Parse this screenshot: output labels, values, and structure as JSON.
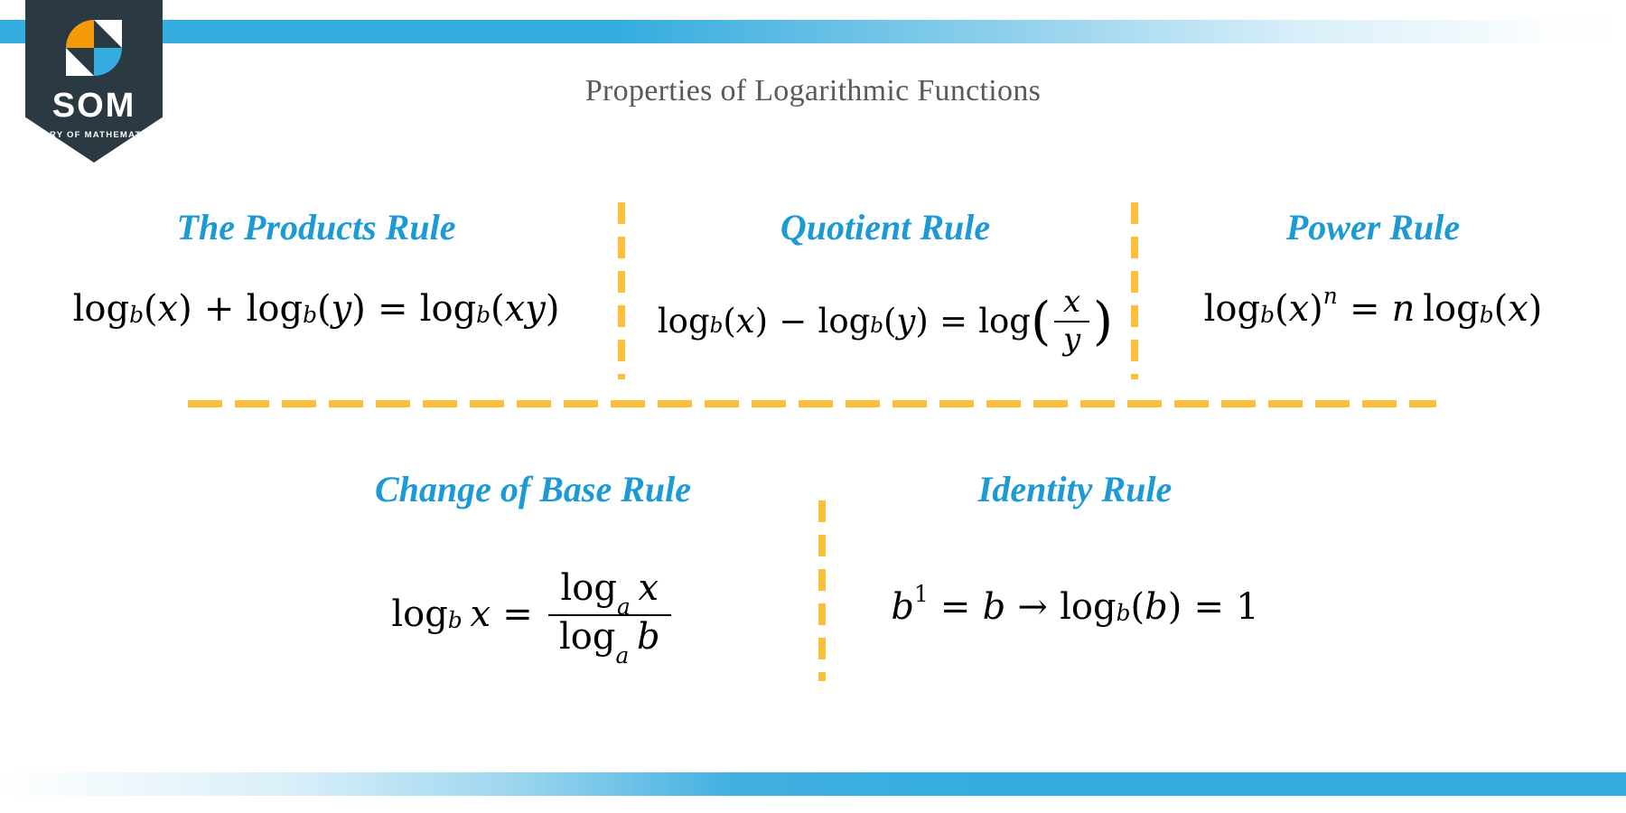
{
  "slide": {
    "title": "Properties of Logarithmic Functions",
    "accent_blue": "#35ACDF",
    "heading_blue": "#1C9AD6",
    "divider_yellow": "#FBBF3B",
    "badge_dark": "#2B3A42",
    "logo_orange": "#F59B0B",
    "title_gray": "#58595B"
  },
  "logo": {
    "wordmark": "SOM",
    "tagline": "STORY OF MATHEMATICS"
  },
  "rules": {
    "products": {
      "heading": "The Products Rule",
      "formula_text": "log_b(x) + log_b(y) = log_b(xy)",
      "log": "log",
      "base_b": "b",
      "x": "x",
      "y": "y",
      "plus": "+",
      "equals": "=",
      "open": "(",
      "close": ")",
      "xy": "xy"
    },
    "quotient": {
      "heading": "Quotient Rule",
      "formula_text": "log_b(x) - log_b(y) = log(x/y)",
      "log": "log",
      "base_b": "b",
      "x": "x",
      "y": "y",
      "minus": "−",
      "equals": "=",
      "open": "(",
      "close": ")"
    },
    "power": {
      "heading": "Power Rule",
      "formula_text": "log_b(x)^n = n log_b(x)",
      "log": "log",
      "base_b": "b",
      "x": "x",
      "n": "n",
      "equals": "=",
      "open": "(",
      "close": ")"
    },
    "change_of_base": {
      "heading": "Change of Base Rule",
      "formula_text": "log_b x = (log_a x) / (log_a b)",
      "log": "log",
      "base_b": "b",
      "base_a": "a",
      "x": "x",
      "b": "b",
      "equals": "="
    },
    "identity": {
      "heading": "Identity Rule",
      "formula_text": "b^1 = b → log_b(b) = 1",
      "log": "log",
      "base_b": "b",
      "b": "b",
      "one_sup": "1",
      "one": "1",
      "equals": "=",
      "arrow": "→",
      "open": "(",
      "close": ")"
    }
  }
}
